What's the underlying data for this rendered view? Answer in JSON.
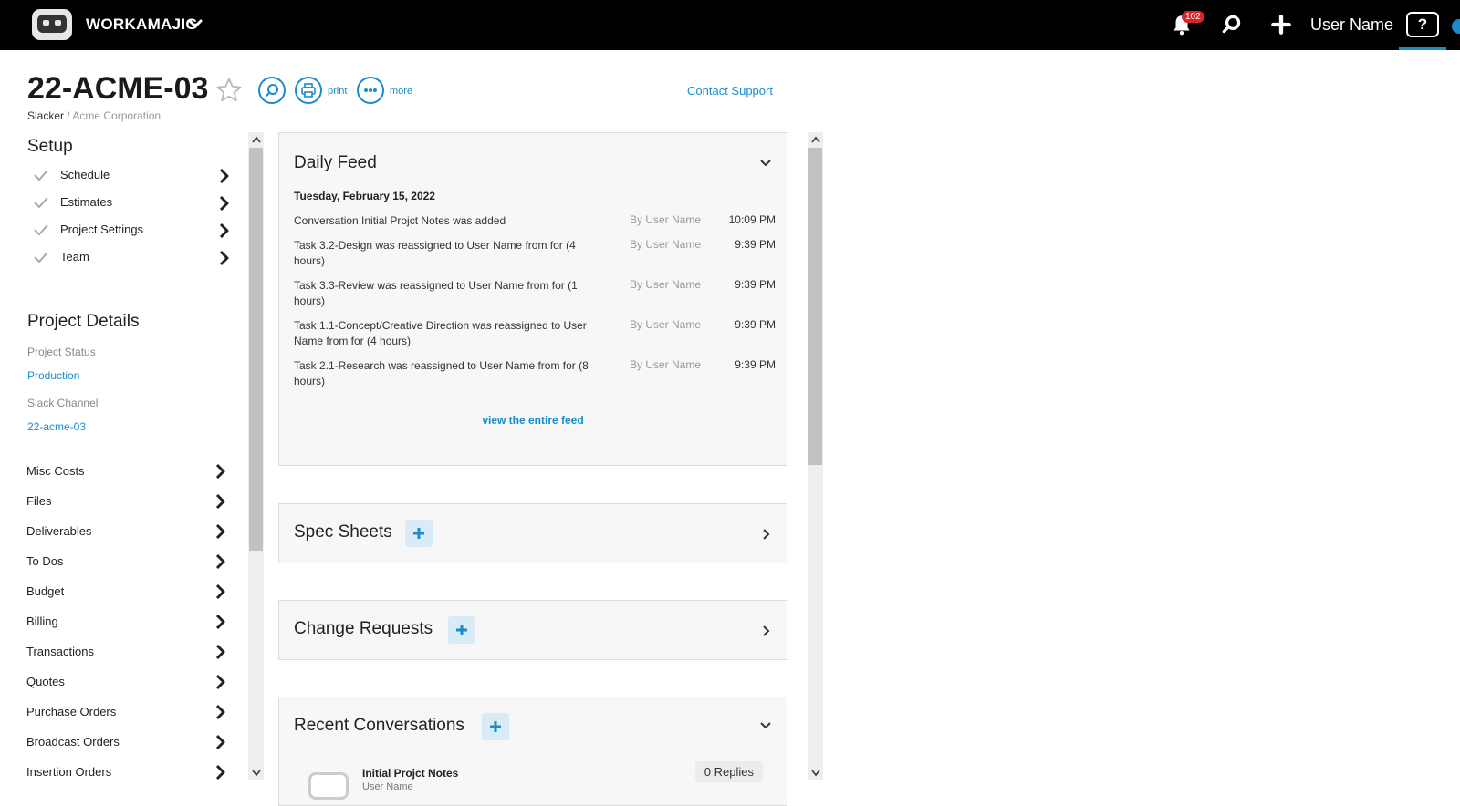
{
  "topbar": {
    "brand": "WORKAMAJIG",
    "notification_count": "102",
    "user_name": "User Name",
    "help_label": "?"
  },
  "header": {
    "project_code": "22-ACME-03",
    "print_label": "print",
    "more_label": "more",
    "contact_support": "Contact Support",
    "breadcrumb_client": "Slacker",
    "breadcrumb_sep": " / ",
    "breadcrumb_company": "Acme Corporation"
  },
  "sidebar": {
    "setup_title": "Setup",
    "setup_items": [
      {
        "label": "Schedule"
      },
      {
        "label": "Estimates"
      },
      {
        "label": "Project Settings"
      },
      {
        "label": "Team"
      }
    ],
    "details_title": "Project Details",
    "project_status_label": "Project Status",
    "project_status_value": "Production",
    "slack_channel_label": "Slack Channel",
    "slack_channel_value": "22-acme-03",
    "nav_items": [
      {
        "label": "Misc Costs"
      },
      {
        "label": "Files"
      },
      {
        "label": "Deliverables"
      },
      {
        "label": "To Dos"
      },
      {
        "label": "Budget"
      },
      {
        "label": "Billing"
      },
      {
        "label": "Transactions"
      },
      {
        "label": "Quotes"
      },
      {
        "label": "Purchase Orders"
      },
      {
        "label": "Broadcast Orders"
      },
      {
        "label": "Insertion Orders"
      }
    ]
  },
  "daily_feed": {
    "title": "Daily Feed",
    "date": "Tuesday, February 15, 2022",
    "entries": [
      {
        "text": "Conversation Initial Projct Notes was added",
        "by": "By User Name",
        "time": "10:09 PM"
      },
      {
        "text": "Task 3.2-Design was reassigned to User Name from for (4 hours)",
        "by": "By User Name",
        "time": "9:39 PM"
      },
      {
        "text": "Task 3.3-Review was reassigned to User Name from for (1 hours)",
        "by": "By User Name",
        "time": "9:39 PM"
      },
      {
        "text": "Task 1.1-Concept/Creative Direction was reassigned to User Name from for (4 hours)",
        "by": "By User Name",
        "time": "9:39 PM"
      },
      {
        "text": "Task 2.1-Research was reassigned to User Name from for (8 hours)",
        "by": "By User Name",
        "time": "9:39 PM"
      }
    ],
    "view_all": "view the entire feed"
  },
  "spec_sheets": {
    "title": "Spec Sheets"
  },
  "change_requests": {
    "title": "Change Requests"
  },
  "recent_conversations": {
    "title": "Recent Conversations",
    "items": [
      {
        "title": "Initial Projct Notes",
        "subtitle": "User Name",
        "replies": "0 Replies"
      }
    ]
  },
  "colors": {
    "accent": "#1a8ccc",
    "topbar": "#000000",
    "badge": "#d6262c"
  }
}
